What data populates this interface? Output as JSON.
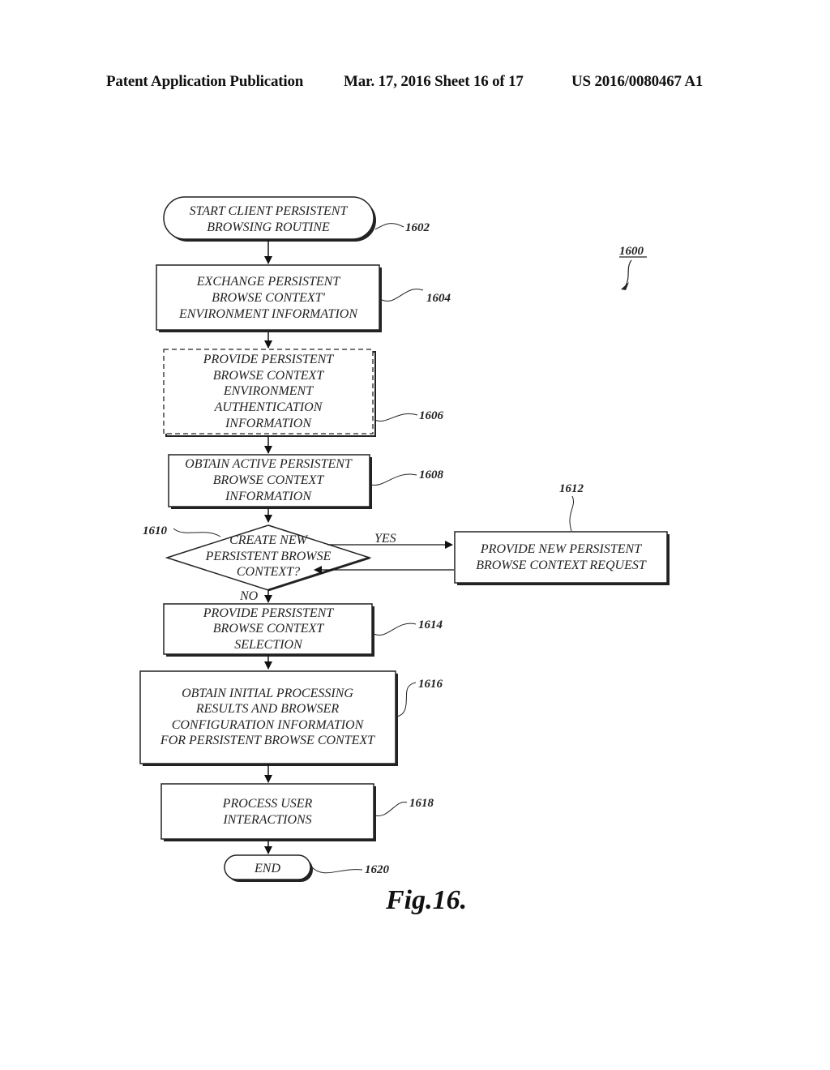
{
  "header": {
    "left": "Patent Application Publication",
    "middle": "Mar. 17, 2016  Sheet 16 of 17",
    "right": "US 2016/0080467 A1"
  },
  "figure": {
    "id": "1600",
    "caption": "Fig.16."
  },
  "nodes": {
    "n1602": {
      "ref": "1602",
      "lines": [
        "START CLIENT PERSISTENT",
        "BROWSING ROUTINE"
      ]
    },
    "n1604": {
      "ref": "1604",
      "lines": [
        "EXCHANGE PERSISTENT",
        "BROWSE CONTEXT'",
        "ENVIRONMENT INFORMATION"
      ]
    },
    "n1606": {
      "ref": "1606",
      "lines": [
        "PROVIDE PERSISTENT",
        "BROWSE CONTEXT",
        "ENVIRONMENT",
        "AUTHENTICATION",
        "INFORMATION"
      ]
    },
    "n1608": {
      "ref": "1608",
      "lines": [
        "OBTAIN ACTIVE PERSISTENT",
        "BROWSE CONTEXT",
        "INFORMATION"
      ]
    },
    "n1610": {
      "ref": "1610",
      "lines": [
        "CREATE NEW",
        "PERSISTENT BROWSE",
        "CONTEXT?"
      ]
    },
    "n1612": {
      "ref": "1612",
      "lines": [
        "PROVIDE NEW PERSISTENT",
        "BROWSE CONTEXT REQUEST"
      ]
    },
    "n1614": {
      "ref": "1614",
      "lines": [
        "PROVIDE PERSISTENT",
        "BROWSE CONTEXT",
        "SELECTION"
      ]
    },
    "n1616": {
      "ref": "1616",
      "lines": [
        "OBTAIN INITIAL PROCESSING",
        "RESULTS AND BROWSER",
        "CONFIGURATION INFORMATION",
        "FOR PERSISTENT BROWSE CONTEXT"
      ]
    },
    "n1618": {
      "ref": "1618",
      "lines": [
        "PROCESS USER",
        "INTERACTIONS"
      ]
    },
    "n1620": {
      "ref": "1620",
      "lines": [
        "END"
      ]
    }
  },
  "edges": {
    "yes": "YES",
    "no": "NO"
  }
}
